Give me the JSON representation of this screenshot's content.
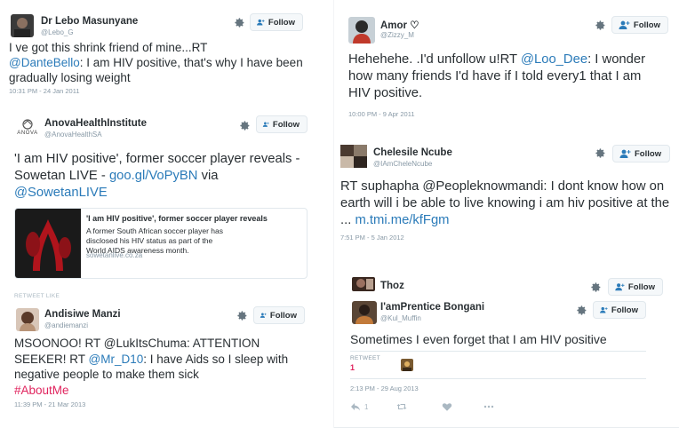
{
  "follow_label": "Follow",
  "icons": {
    "settings": "gear-icon",
    "follow": "person-plus-icon",
    "reply": "reply-icon",
    "retweet": "retweet-icon",
    "like": "heart-icon",
    "more": "more-icon"
  },
  "colors": {
    "link": "#2b7bb9",
    "hashtag": "#e0245e",
    "meta": "#8899a6"
  },
  "tweets": {
    "lebo": {
      "name": "Dr Lebo Masunyane",
      "handle": "@Lebo_G",
      "text_1": "I ve got this shrink friend of mine...RT",
      "mention": "@DanteBello",
      "text_2": ": I am HIV positive, that's why I have been gradually losing weight",
      "time": "10:31 PM - 24 Jan 2011"
    },
    "anova": {
      "name": "AnovaHealthInstitute",
      "handle": "@AnovaHealthSA",
      "avatar_text": "ANOVA",
      "text_1": "'I am HIV positive', former soccer player reveals - Sowetan LIVE  -",
      "link": "goo.gl/VoPyBN",
      "text_2": " via",
      "mention": "@SowetanLIVE",
      "card_title": "'I am HIV positive', former soccer player reveals",
      "card_desc": "A former South African soccer player has disclosed his HIV status as part of the World AIDS awareness month.",
      "card_domain": "sowetanlive.co.za",
      "cut_off_text": "RETWEET    LIKE"
    },
    "andisiwe": {
      "name": "Andisiwe Manzi",
      "handle": "@andiemanzi",
      "text_1": "MSOONOO! RT @LukItsChuma: ATTENTION SEEKER! RT",
      "mention": "@Mr_D10",
      "text_2": ": I have Aids so I sleep with negative people to make them sick",
      "hashtag": "#AboutMe",
      "time": "11:39 PM - 21 Mar 2013"
    },
    "amor": {
      "name": "Amor ♡",
      "handle": "@Zizzy_M",
      "text_1": "Hehehehe. .I'd unfollow u!RT",
      "mention": "@Loo_Dee",
      "text_2": ": I wonder how many friends I'd have if I told every1 that I am HIV positive.",
      "time": "10:00 PM - 9 Apr 2011"
    },
    "chelesile": {
      "name": "Chelesile Ncube",
      "handle": "@IAmCheleNcube",
      "text_1": "RT suphapha  @Peopleknowmandi: I dont know how on earth will i be able to live knowing i am hiv positive at the ...",
      "link": "m.tmi.me/kfFgm",
      "time": "7:51 PM - 5 Jan 2012"
    },
    "thoz": {
      "name": "Thoz"
    },
    "bongani": {
      "name": "I'amPrentice Bongani",
      "handle": "@Kul_Muffin",
      "text": "Sometimes I even forget that I am HIV positive",
      "retweet_label": "RETWEET",
      "retweet_count": "1",
      "time": "2:13 PM - 29 Aug 2013",
      "reply_count": "1"
    }
  }
}
